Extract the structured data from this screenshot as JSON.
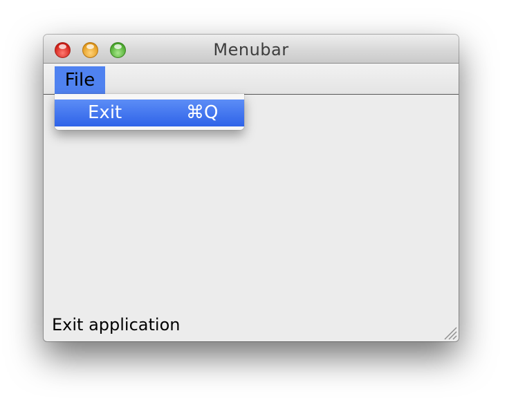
{
  "window": {
    "title": "Menubar"
  },
  "menubar": {
    "menus": [
      {
        "label": "File"
      }
    ]
  },
  "dropdown": {
    "items": [
      {
        "label": "Exit",
        "shortcut": "⌘Q"
      }
    ]
  },
  "statusbar": {
    "text": "Exit application"
  },
  "icons": [
    "close-icon",
    "minimize-icon",
    "zoom-icon",
    "resize-grip-icon"
  ],
  "colors": {
    "selection": "#4f82f0",
    "close": "#d11d15",
    "minimize": "#e39b1c",
    "zoom": "#4aa92c"
  }
}
